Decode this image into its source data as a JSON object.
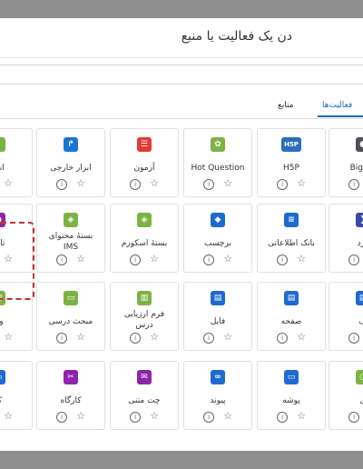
{
  "modal": {
    "title": "دن یک فعالیت یا منبع",
    "tabs": {
      "activities": "فعالیت‌ها",
      "resources": "منابع"
    }
  },
  "icons": {
    "info": "ⓘ",
    "star": "☆"
  },
  "tiles": [
    {
      "row": 0,
      "col": "c5",
      "label": "BigBlu",
      "color": "#4a4f5a",
      "glyph": "◐",
      "icon_name": "bigbluebutton-icon"
    },
    {
      "row": 0,
      "col": "c4",
      "label": "H5P",
      "color": "#2a6fb7",
      "glyph": "H5P",
      "icon_name": "h5p-icon"
    },
    {
      "row": 0,
      "col": "c3",
      "label": "Hot Question",
      "color": "#7cb342",
      "glyph": "✿",
      "icon_name": "hot-question-icon"
    },
    {
      "row": 0,
      "col": "c2",
      "label": "آزمون",
      "color": "#e53935",
      "glyph": "☰",
      "icon_name": "quiz-icon"
    },
    {
      "row": 0,
      "col": "c1",
      "label": "ابزار خارجی",
      "color": "#1976d2",
      "glyph": "↱",
      "icon_name": "external-tool-icon"
    },
    {
      "row": 0,
      "col": "c0",
      "label": "انت",
      "color": "#7cb342",
      "glyph": "✓",
      "icon_name": "choice-icon"
    },
    {
      "row": 1,
      "col": "c5",
      "label": "ورد",
      "color": "#3949ab",
      "glyph": "❯",
      "icon_name": "glossary-icon"
    },
    {
      "row": 1,
      "col": "c4",
      "label": "بانک اطلاعاتی",
      "color": "#1e6ad0",
      "glyph": "≡",
      "icon_name": "database-icon"
    },
    {
      "row": 1,
      "col": "c3",
      "label": "برچسب",
      "color": "#1e6ad0",
      "glyph": "◆",
      "icon_name": "label-icon"
    },
    {
      "row": 1,
      "col": "c2",
      "label": "بستهٔ اسکورم",
      "color": "#7cb342",
      "glyph": "◈",
      "icon_name": "scorm-icon"
    },
    {
      "row": 1,
      "col": "c1",
      "label": "بستهٔ محتوای IMS",
      "color": "#7cb342",
      "glyph": "◈",
      "icon_name": "ims-package-icon"
    },
    {
      "row": 1,
      "col": "c0",
      "label": "تالار",
      "color": "#8e24aa",
      "glyph": "●",
      "icon_name": "forum-icon"
    },
    {
      "row": 2,
      "col": "c5",
      "label": "ف",
      "color": "#1e6ad0",
      "glyph": "▤",
      "icon_name": "book-icon"
    },
    {
      "row": 2,
      "col": "c4",
      "label": "صفحه",
      "color": "#1e6ad0",
      "glyph": "▤",
      "icon_name": "page-icon"
    },
    {
      "row": 2,
      "col": "c3",
      "label": "فایل",
      "color": "#1e6ad0",
      "glyph": "▤",
      "icon_name": "file-icon"
    },
    {
      "row": 2,
      "col": "c2",
      "label": "فرم ارزیابی درس",
      "color": "#7cb342",
      "glyph": "▥",
      "icon_name": "feedback-icon"
    },
    {
      "row": 2,
      "col": "c1",
      "label": "مبحث درسی",
      "color": "#7cb342",
      "glyph": "▭",
      "icon_name": "lesson-icon"
    },
    {
      "row": 2,
      "col": "c0",
      "label": "واژ",
      "color": "#7cb342",
      "glyph": "▤",
      "icon_name": "glossary2-icon"
    },
    {
      "row": 3,
      "col": "c5",
      "label": "ی",
      "color": "#7cb342",
      "glyph": "◔",
      "icon_name": "survey-icon"
    },
    {
      "row": 3,
      "col": "c4",
      "label": "پوشه",
      "color": "#1e6ad0",
      "glyph": "▭",
      "icon_name": "folder-icon"
    },
    {
      "row": 3,
      "col": "c3",
      "label": "پیوند",
      "color": "#1e6ad0",
      "glyph": "∞",
      "icon_name": "url-icon"
    },
    {
      "row": 3,
      "col": "c2",
      "label": "چت متنی",
      "color": "#8e24aa",
      "glyph": "✉",
      "icon_name": "chat-icon"
    },
    {
      "row": 3,
      "col": "c1",
      "label": "کارگاه",
      "color": "#8e24aa",
      "glyph": "✂",
      "icon_name": "workshop-icon"
    },
    {
      "row": 3,
      "col": "c0",
      "label": "ک",
      "color": "#1e6ad0",
      "glyph": "▭",
      "icon_name": "wiki-icon"
    }
  ]
}
